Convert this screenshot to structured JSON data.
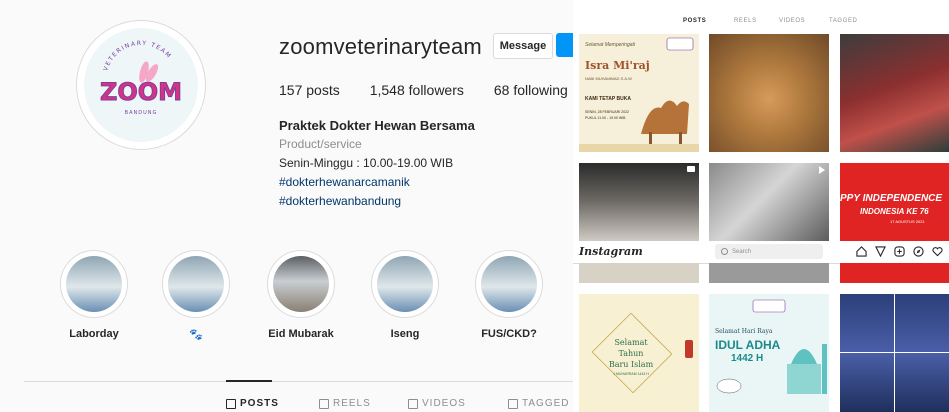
{
  "profile": {
    "username": "zoomveterinaryteam",
    "message_label": "Message",
    "stats": {
      "posts": "157 posts",
      "followers": "1,548 followers",
      "following": "68 following"
    },
    "bio": {
      "name": "Praktek Dokter Hewan Bersama",
      "category": "Product/service",
      "hours": "Senin-Minggu : 10.00-19.00 WIB",
      "hashtags": [
        "#dokterhewanarcamanik",
        "#dokterhewanbandung"
      ]
    },
    "logo": {
      "brand": "ZOOM",
      "arc_text": "VETERINARY TEAM",
      "city": "BANDUNG"
    }
  },
  "highlights": [
    {
      "label": "Laborday"
    },
    {
      "label": "🐾"
    },
    {
      "label": "Eid Mubarak"
    },
    {
      "label": "Iseng"
    },
    {
      "label": "FUS/CKD?"
    }
  ],
  "profile_tabs": [
    {
      "label": "POSTS",
      "icon": "grid-icon",
      "active": true
    },
    {
      "label": "REELS",
      "icon": "reels-icon",
      "active": false
    },
    {
      "label": "VIDEOS",
      "icon": "video-icon",
      "active": false
    },
    {
      "label": "TAGGED",
      "icon": "tag-icon",
      "active": false
    }
  ],
  "mini_tabs": [
    "POSTS",
    "REELS",
    "VIDEOS",
    "TAGGED"
  ],
  "topbar": {
    "logo": "Instagram",
    "search_placeholder": "Search",
    "icons": [
      "home-icon",
      "direct-icon",
      "new-post-icon",
      "explore-icon",
      "heart-icon"
    ]
  },
  "posts": {
    "isra_miraj": {
      "heading": "Selamat Memperingati",
      "title": "Isra Mi'raj",
      "sub": "NABI MUHAMMAD S.A.W",
      "open": "KAMI TETAP BUKA",
      "date": "SENIN, 28 FEBRUARI 2022",
      "time": "PUKUL 11.00 - 19.00 WIB"
    },
    "independence": {
      "title": "PPY INDEPENDENCE",
      "sub": "INDONESIA KE 76",
      "date": "17 AGUSTUS 2021"
    },
    "new_year": {
      "line1": "Selamat",
      "line2": "Tahun",
      "line3": "Baru Islam",
      "sub": "1 MUHARRAM 1443 H"
    },
    "idul_adha": {
      "line1": "Selamat Hari Raya",
      "title": "IDUL ADHA",
      "year": "1442 H"
    }
  },
  "colors": {
    "accent": "#0095f6",
    "text": "#262626",
    "muted": "#8e8e8e",
    "link": "#00376b",
    "brand_pink": "#d63384",
    "brand_purple": "#7b3fa0",
    "independence_red": "#e02424"
  }
}
